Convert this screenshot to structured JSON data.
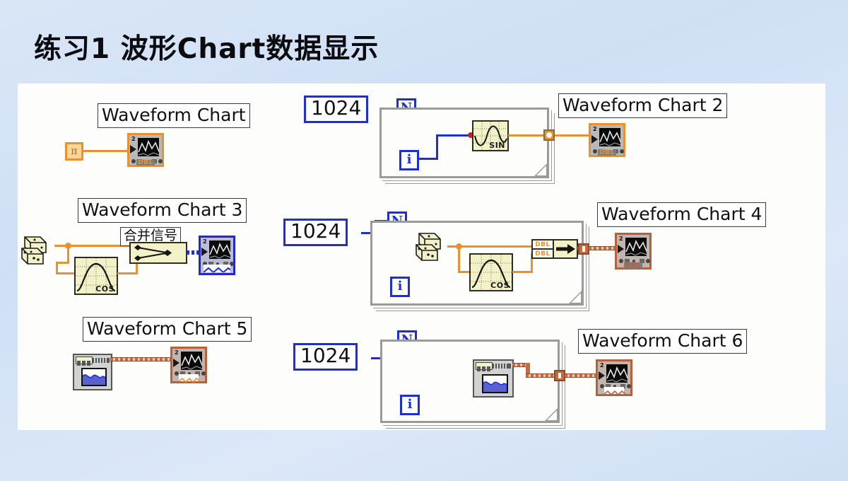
{
  "slide": {
    "title": "练习1 波形Chart数据显示",
    "background_color": "#d4e2f4",
    "panel_color": "#fdfdfb"
  },
  "palette": {
    "wire_dbl": "#e8922f",
    "wire_i32": "#1c2fd6",
    "wire_dynamic": "#1c2fd6",
    "wire_array": "#c86a3c",
    "loop_border": "#9a9a9a",
    "terminal_orange": "#e8922f",
    "terminal_blue": "#2727c8",
    "terminal_brown": "#b4613c",
    "function_body": "#f2f1c8",
    "coercion_dot": "#d21b1b"
  },
  "labels": {
    "chart1": "Waveform Chart",
    "chart2": "Waveform Chart 2",
    "chart3": "Waveform Chart 3",
    "chart4": "Waveform Chart 4",
    "chart5": "Waveform Chart 5",
    "chart6": "Waveform Chart 6",
    "merge_signals": "合并信号"
  },
  "constants": {
    "pi": "π",
    "count1": "1024",
    "count2": "1024",
    "count3": "1024"
  },
  "loops": {
    "count_terminal": "N",
    "iteration_terminal": "i"
  },
  "functions": {
    "sin": "SIN",
    "cos_row2": "COS",
    "cos_row3": "COS",
    "random_number": "random-number-dice",
    "simulate_signal": "simulate-signal-vi",
    "build_array": "build-array-node"
  },
  "terminals": {
    "datatype_dbl": "DBL",
    "chart1_type": "DBL",
    "chart2_type": "DBL",
    "chart3_type": "DBL",
    "chart4_type": "DBL",
    "chart5_type": "DBL",
    "chart6_type": "DBL"
  },
  "rows": [
    {
      "name": "row-1-sine",
      "source": "π constant",
      "loop_count": "1024",
      "inner_function": "SIN",
      "outputs": [
        "Waveform Chart",
        "Waveform Chart 2"
      ]
    },
    {
      "name": "row-2-merge-cosine",
      "source": "random number (dice)",
      "loop_count": "1024",
      "inner_function": "COS",
      "combiner": "合并信号",
      "outputs": [
        "Waveform Chart 3",
        "Waveform Chart 4"
      ]
    },
    {
      "name": "row-3-simulate-signal",
      "source": "simulate signal express VI",
      "loop_count": "1024",
      "outputs": [
        "Waveform Chart 5",
        "Waveform Chart 6"
      ]
    }
  ]
}
